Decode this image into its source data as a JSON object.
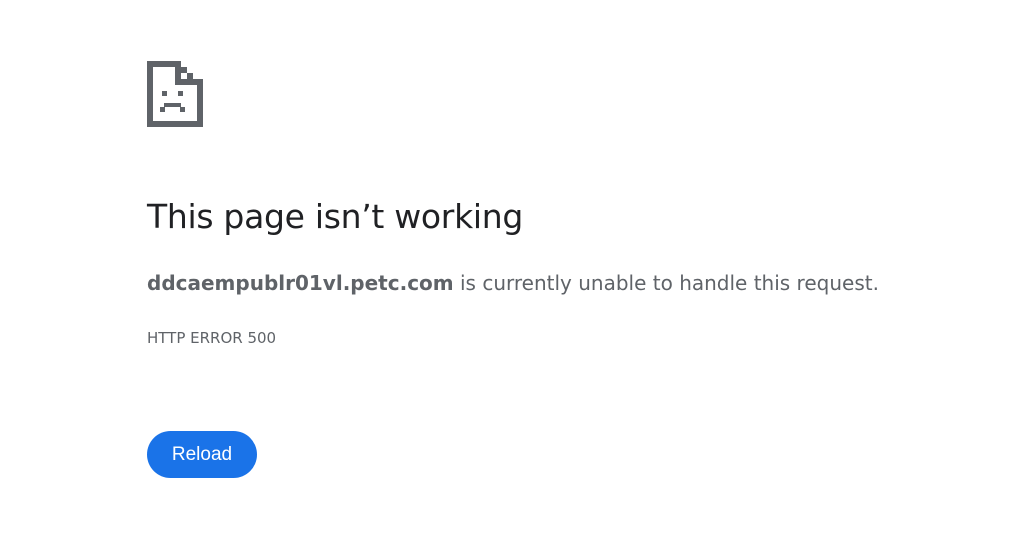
{
  "error_page": {
    "icon": "sad-page-icon",
    "title": "This page isn’t working",
    "host": "ddcaempublr01vl.petc.com",
    "message_suffix": " is currently unable to handle this request.",
    "error_code": "HTTP ERROR 500",
    "reload_label": "Reload",
    "colors": {
      "button": "#1a73e8",
      "button_text": "#ffffff",
      "title": "#202124",
      "body_text": "#5f6368",
      "icon": "#5f6368"
    }
  }
}
